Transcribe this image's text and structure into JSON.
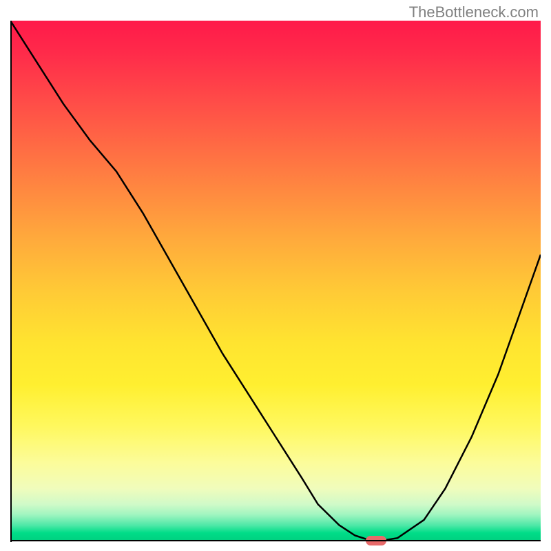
{
  "watermark": "TheBottleneck.com",
  "chart_data": {
    "type": "line",
    "title": "",
    "xlabel": "",
    "ylabel": "",
    "xlim": [
      0,
      100
    ],
    "ylim": [
      0,
      100
    ],
    "x": [
      0,
      5,
      10,
      15,
      20,
      25,
      30,
      35,
      40,
      45,
      50,
      55,
      58,
      62,
      65,
      68,
      70,
      73,
      78,
      82,
      87,
      92,
      100
    ],
    "values": [
      100,
      92,
      84,
      77,
      71,
      63,
      54,
      45,
      36,
      28,
      20,
      12,
      7,
      3,
      1,
      0,
      0,
      0.5,
      4,
      10,
      20,
      32,
      55
    ],
    "marker": {
      "x": 69,
      "y": 0
    },
    "background": "rainbow_gradient_red_to_green"
  }
}
